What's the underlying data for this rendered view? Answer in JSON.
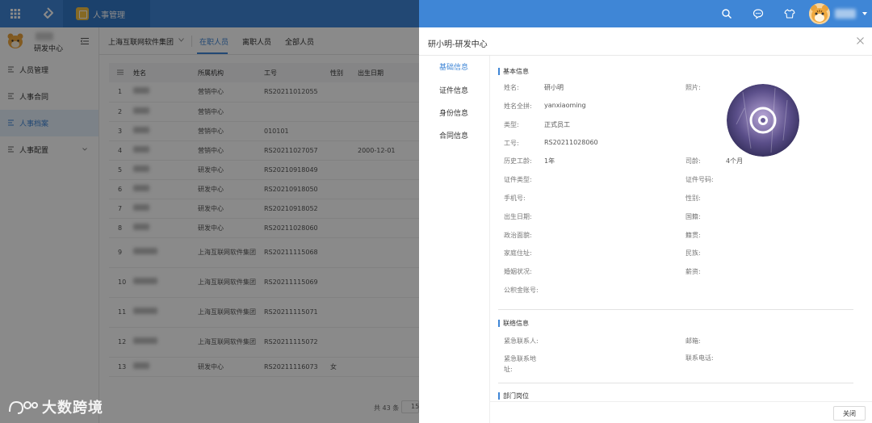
{
  "topbar": {
    "app_tab_label": "人事管理"
  },
  "sidebar": {
    "org_name": "研发中心",
    "items": [
      {
        "label": "人员管理"
      },
      {
        "label": "人事合同"
      },
      {
        "label": "人事档案"
      },
      {
        "label": "人事配置"
      }
    ],
    "active_index": 2
  },
  "main": {
    "company_select": "上海互联网软件集团",
    "tabs": [
      {
        "label": "在职人员"
      },
      {
        "label": "离职人员"
      },
      {
        "label": "全部人员"
      }
    ],
    "table": {
      "headers": [
        "姓名",
        "所属机构",
        "工号",
        "性别",
        "出生日期"
      ],
      "rows": [
        {
          "no": "1",
          "org": "营销中心",
          "id": "RS20211012055",
          "gender": "",
          "birth": ""
        },
        {
          "no": "2",
          "org": "营销中心",
          "id": "",
          "gender": "",
          "birth": ""
        },
        {
          "no": "3",
          "org": "营销中心",
          "id": "010101",
          "gender": "",
          "birth": ""
        },
        {
          "no": "4",
          "org": "营销中心",
          "id": "RS20211027057",
          "gender": "",
          "birth": "2000-12-01"
        },
        {
          "no": "5",
          "org": "研发中心",
          "id": "RS20210918049",
          "gender": "",
          "birth": ""
        },
        {
          "no": "6",
          "org": "研发中心",
          "id": "RS20210918050",
          "gender": "",
          "birth": ""
        },
        {
          "no": "7",
          "org": "研发中心",
          "id": "RS20210918052",
          "gender": "",
          "birth": ""
        },
        {
          "no": "8",
          "org": "研发中心",
          "id": "RS20211028060",
          "gender": "",
          "birth": ""
        },
        {
          "no": "9",
          "org": "上海互联网软件集团",
          "id": "RS20211115068",
          "gender": "",
          "birth": ""
        },
        {
          "no": "10",
          "org": "上海互联网软件集团",
          "id": "RS20211115069",
          "gender": "",
          "birth": ""
        },
        {
          "no": "11",
          "org": "上海互联网软件集团",
          "id": "RS20211115071",
          "gender": "",
          "birth": ""
        },
        {
          "no": "12",
          "org": "上海互联网软件集团",
          "id": "RS20211115072",
          "gender": "",
          "birth": ""
        },
        {
          "no": "13",
          "org": "研发中心",
          "id": "RS20211116073",
          "gender": "女",
          "birth": ""
        }
      ]
    },
    "pager": {
      "total_text": "共 43 条",
      "page_size": "15"
    }
  },
  "drawer": {
    "title": "研小明-研发中心",
    "nav": [
      {
        "label": "基础信息"
      },
      {
        "label": "证件信息"
      },
      {
        "label": "身份信息"
      },
      {
        "label": "合同信息"
      }
    ],
    "sections": {
      "basic": "基本信息",
      "contact": "联络信息",
      "dept": "部门岗位"
    },
    "fields": {
      "name_label": "姓名:",
      "name_value": "研小明",
      "photo_label": "照片:",
      "pinyin_label": "姓名全拼:",
      "pinyin_value": "yanxiaoming",
      "type_label": "类型:",
      "type_value": "正式员工",
      "id_label": "工号:",
      "id_value": "RS20211028060",
      "history_label": "历史工龄:",
      "history_value": "1年",
      "tenure_label": "司龄:",
      "tenure_value": "4个月",
      "idtype_label": "证件类型:",
      "idno_label": "证件号码:",
      "phone_label": "手机号:",
      "gender_label": "性别:",
      "birth_label": "出生日期:",
      "nation_label": "国籍:",
      "political_label": "政治面貌:",
      "native_label": "籍贯:",
      "address_label": "家庭住址:",
      "ethnic_label": "民族:",
      "marital_label": "婚姻状况:",
      "salary_label": "薪资:",
      "fund_label": "公积金账号:",
      "emergency_label": "紧急联系人:",
      "email_label": "邮箱:",
      "emergency_addr_label": "紧急联系地址:",
      "contact_phone_label": "联系电话:"
    },
    "close_button": "关闭"
  },
  "watermark": "大数跨境"
}
